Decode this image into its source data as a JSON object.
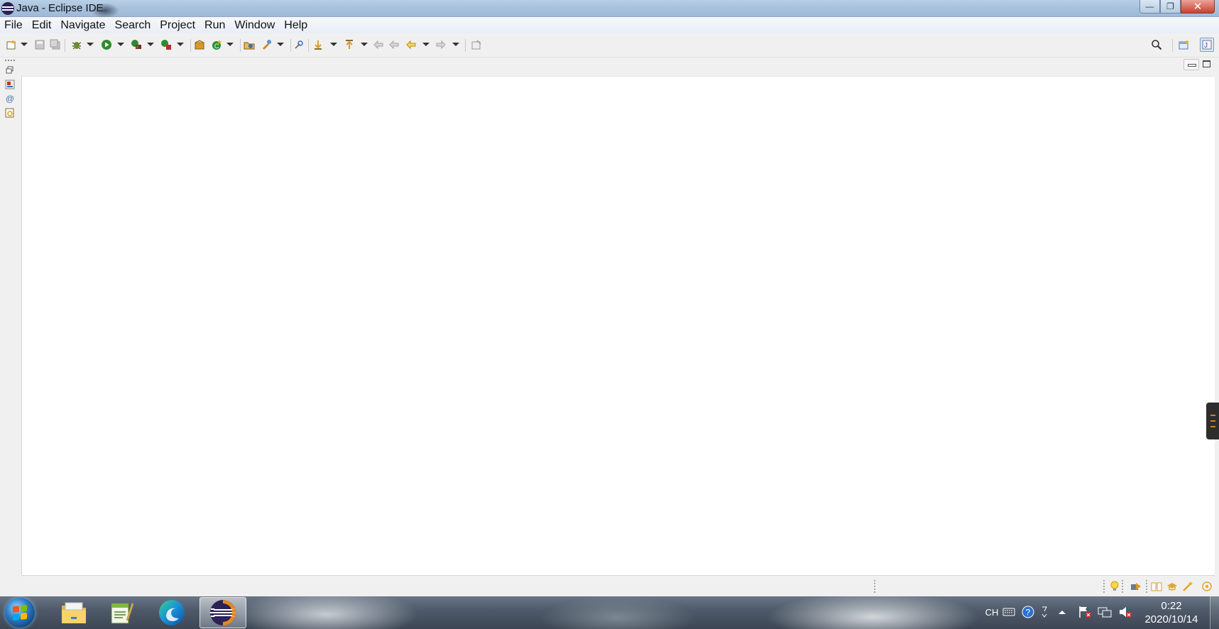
{
  "window": {
    "title": "Java - Eclipse IDE",
    "app_icon": "eclipse-icon",
    "controls": [
      "minimize-icon",
      "restore-icon",
      "close-icon"
    ],
    "close_glyph": "✕",
    "minimize_glyph": "—",
    "restore_glyph": "❐"
  },
  "menu": {
    "items": [
      "File",
      "Edit",
      "Navigate",
      "Search",
      "Project",
      "Run",
      "Window",
      "Help"
    ]
  },
  "toolbar": {
    "buttons": [
      "new-icon",
      "save-icon",
      "save-all-icon",
      "debug-icon",
      "run-icon",
      "coverage-icon",
      "external-tools-icon",
      "new-java-package-icon",
      "new-java-class-icon",
      "open-type-icon",
      "open-task-icon",
      "toggle-mark-occurrences-icon",
      "next-annotation-icon",
      "previous-annotation-icon",
      "last-edit-location-icon",
      "back-icon",
      "forward-icon",
      "pin-editor-icon",
      "search-icon",
      "open-perspective-icon",
      "java-perspective-icon"
    ]
  },
  "left_trim": {
    "items": [
      "restore-icon",
      "package-explorer-icon",
      "javadoc-icon",
      "declaration-icon"
    ]
  },
  "editor_area": {
    "controls": [
      "minimize-icon",
      "maximize-icon"
    ]
  },
  "status_bar": {
    "icons": [
      "tip-icon",
      "welcome-icon",
      "tutorials-icon",
      "samples-icon",
      "whats-new-icon",
      "overview-icon"
    ]
  },
  "taskbar": {
    "apps": [
      "file-explorer-icon",
      "notepad-icon",
      "edge-icon",
      "eclipse-icon"
    ],
    "active_app": "eclipse-icon",
    "tray": {
      "language": "CH",
      "icons": [
        "keyboard-icon",
        "help-icon",
        "input-arrow-icon",
        "show-hidden-icon",
        "action-center-icon",
        "network-icon",
        "volume-muted-icon"
      ]
    },
    "clock": {
      "time": "0:22",
      "date": "2020/10/14"
    }
  },
  "colors": {
    "titlebar": "#a7c1dc",
    "close_button": "#c7412f",
    "editor_background": "#ffffff",
    "chrome_background": "#f0f0f0"
  }
}
